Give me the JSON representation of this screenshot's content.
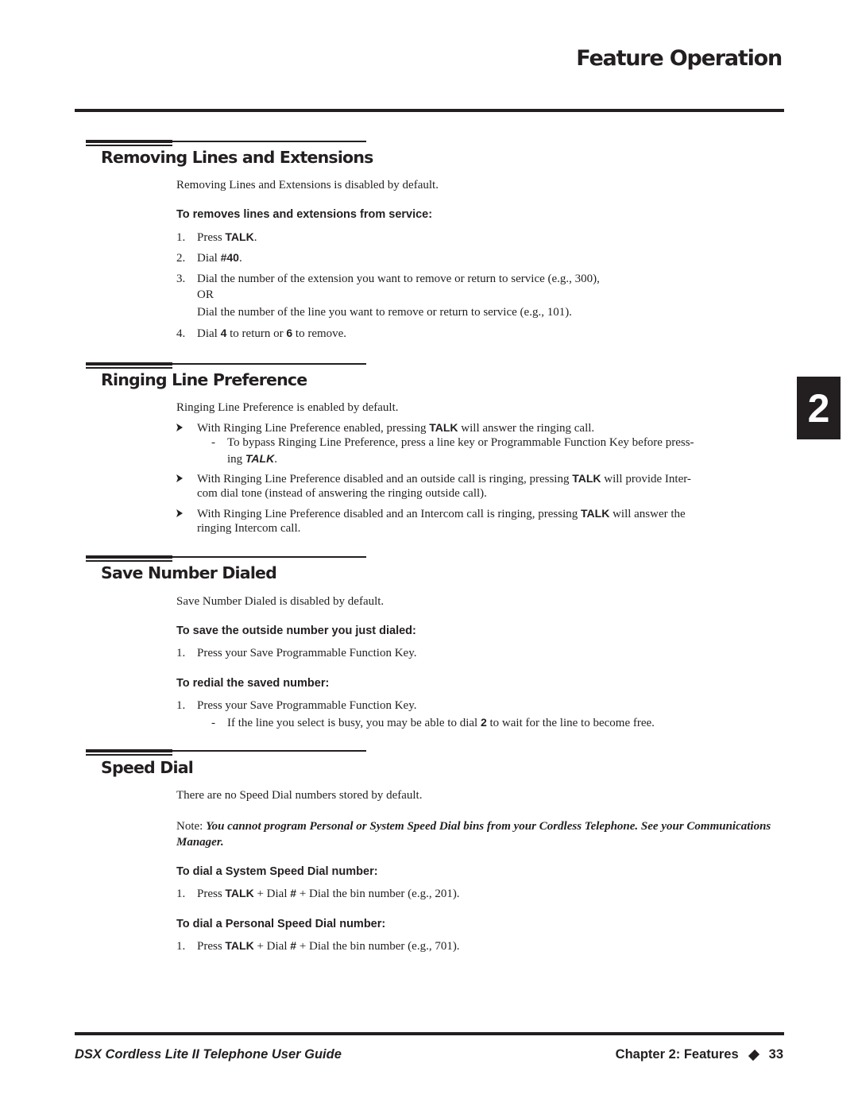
{
  "header": {
    "title": "Feature Operation"
  },
  "chapter_tab": {
    "number": "2"
  },
  "sections": {
    "removing": {
      "title": "Removing Lines and Extensions",
      "intro": "Removing Lines and Extensions is disabled by default.",
      "procedure_heading": "To removes lines and extensions from service:",
      "steps": [
        {
          "num": "1.",
          "pre": "Press ",
          "key": "TALK",
          "post": "."
        },
        {
          "num": "2.",
          "pre": "Dial ",
          "key": "#40",
          "post": "."
        },
        {
          "num": "3.",
          "text": "Dial the number of the extension you want to remove or return to service (e.g., 300),",
          "or": "OR",
          "alt": "Dial the number of the line you want to remove or return to service (e.g., 101)."
        },
        {
          "num": "4.",
          "pre": "Dial ",
          "key": "4",
          "mid": " to return or ",
          "key2": "6",
          "post": " to remove."
        }
      ]
    },
    "ringing": {
      "title": "Ringing Line Preference",
      "intro": "Ringing Line Preference is enabled by default.",
      "bullets": [
        {
          "pre": "With Ringing Line Preference enabled, pressing ",
          "key": "TALK",
          "post": " will answer the ringing call.",
          "sub": {
            "line1": "To bypass Ringing Line Preference, press a line key or Programmable Function Key before press-",
            "line2_pre": "ing ",
            "line2_key": "TALK",
            "line2_post": "."
          }
        },
        {
          "pre": "With Ringing Line Preference disabled and an outside call is ringing, pressing ",
          "key": "TALK",
          "post": " will provide Inter-",
          "line2": "com dial tone (instead of answering the ringing outside call)."
        },
        {
          "pre": "With Ringing Line Preference disabled and an Intercom call is ringing, pressing ",
          "key": "TALK",
          "post": " will answer the",
          "line2": "ringing Intercom call."
        }
      ]
    },
    "save": {
      "title": "Save Number Dialed",
      "intro": "Save Number Dialed is disabled by default.",
      "proc1_heading": "To save the outside number you just dialed:",
      "proc1_step": {
        "num": "1.",
        "text": "Press your Save Programmable Function Key."
      },
      "proc2_heading": "To redial the saved number:",
      "proc2_step": {
        "num": "1.",
        "text": "Press your Save Programmable Function Key."
      },
      "proc2_sub": {
        "pre": "If the line you select is busy, you may be able to dial ",
        "key": "2",
        "post": " to wait for the line to become free."
      }
    },
    "speed": {
      "title": "Speed Dial",
      "intro": "There are no Speed Dial numbers stored by default.",
      "note_label": "Note: ",
      "note_text": "You cannot program Personal or System Speed Dial bins from your Cordless Telephone. See your Communications Manager.",
      "proc1_heading": "To dial a System Speed Dial number:",
      "proc1_step": {
        "num": "1.",
        "pre": "Press ",
        "key": "TALK",
        "mid": " + Dial ",
        "key2": "#",
        "post": " + Dial the bin number (e.g., 201)."
      },
      "proc2_heading": "To dial a Personal Speed Dial number:",
      "proc2_step": {
        "num": "1.",
        "pre": "Press ",
        "key": "TALK",
        "mid": " + Dial ",
        "key2": "#",
        "post": " + Dial the bin number (e.g., 701)."
      }
    }
  },
  "footer": {
    "guide_title": "DSX Cordless Lite II Telephone User Guide",
    "chapter": "Chapter 2: Features",
    "separator_icon": "diamond-icon",
    "page_number": "33"
  }
}
